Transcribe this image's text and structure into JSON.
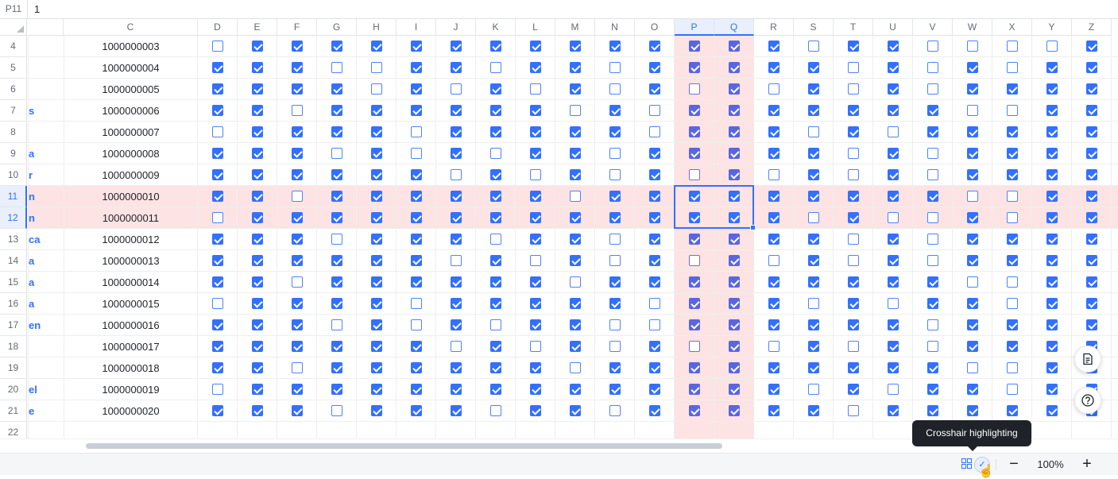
{
  "formula_bar": {
    "cell_ref": "P11",
    "value": "1"
  },
  "columns": [
    "C",
    "D",
    "E",
    "F",
    "G",
    "H",
    "I",
    "J",
    "K",
    "L",
    "M",
    "N",
    "O",
    "P",
    "Q",
    "R",
    "S",
    "T",
    "U",
    "V",
    "W",
    "X",
    "Y",
    "Z"
  ],
  "selected_columns": [
    "P",
    "Q"
  ],
  "selected_rows": [
    "11",
    "12"
  ],
  "checkbox_columns": [
    "D",
    "E",
    "F",
    "G",
    "H",
    "I",
    "J",
    "K",
    "L",
    "M",
    "N",
    "O",
    "P",
    "Q",
    "R",
    "S",
    "T",
    "U",
    "V",
    "W",
    "X",
    "Y",
    "Z"
  ],
  "rows": [
    {
      "num": "4",
      "name": "",
      "id": "1000000003",
      "checks": [
        0,
        1,
        1,
        1,
        1,
        1,
        1,
        1,
        1,
        1,
        1,
        1,
        1,
        1,
        1,
        0,
        1,
        1,
        0,
        0,
        0,
        0,
        1
      ]
    },
    {
      "num": "5",
      "name": "",
      "id": "1000000004",
      "checks": [
        1,
        1,
        1,
        0,
        0,
        1,
        1,
        0,
        1,
        1,
        0,
        1,
        1,
        1,
        1,
        1,
        0,
        1,
        0,
        1,
        0,
        1,
        1
      ]
    },
    {
      "num": "6",
      "name": "",
      "id": "1000000005",
      "checks": [
        1,
        1,
        1,
        1,
        0,
        1,
        0,
        1,
        0,
        1,
        0,
        1,
        0,
        1,
        0,
        1,
        0,
        1,
        0,
        1,
        1,
        1,
        1
      ]
    },
    {
      "num": "7",
      "name": "s",
      "id": "1000000006",
      "checks": [
        1,
        1,
        0,
        1,
        1,
        1,
        1,
        1,
        1,
        0,
        1,
        0,
        1,
        1,
        1,
        1,
        1,
        1,
        1,
        0,
        0,
        1,
        1
      ]
    },
    {
      "num": "8",
      "name": "",
      "id": "1000000007",
      "checks": [
        0,
        1,
        1,
        1,
        1,
        0,
        1,
        1,
        1,
        1,
        1,
        0,
        1,
        1,
        1,
        0,
        1,
        0,
        1,
        1,
        1,
        1,
        1
      ]
    },
    {
      "num": "9",
      "name": "a",
      "id": "1000000008",
      "checks": [
        1,
        1,
        1,
        0,
        1,
        0,
        1,
        0,
        1,
        1,
        0,
        1,
        1,
        1,
        1,
        1,
        0,
        1,
        0,
        1,
        1,
        1,
        1
      ]
    },
    {
      "num": "10",
      "name": "r",
      "id": "1000000009",
      "checks": [
        1,
        1,
        1,
        1,
        1,
        1,
        0,
        1,
        0,
        1,
        0,
        1,
        0,
        1,
        0,
        1,
        0,
        1,
        0,
        1,
        1,
        1,
        1
      ]
    },
    {
      "num": "11",
      "name": "n",
      "id": "1000000010",
      "checks": [
        1,
        1,
        0,
        1,
        1,
        1,
        1,
        1,
        1,
        0,
        1,
        1,
        1,
        1,
        1,
        1,
        1,
        1,
        1,
        0,
        0,
        1,
        1
      ]
    },
    {
      "num": "12",
      "name": "n",
      "id": "1000000011",
      "checks": [
        0,
        1,
        1,
        1,
        1,
        1,
        1,
        1,
        1,
        1,
        1,
        1,
        1,
        1,
        1,
        0,
        1,
        0,
        0,
        1,
        0,
        1,
        1
      ]
    },
    {
      "num": "13",
      "name": "ca",
      "id": "1000000012",
      "checks": [
        1,
        1,
        1,
        0,
        1,
        1,
        1,
        0,
        1,
        1,
        0,
        1,
        1,
        1,
        1,
        1,
        0,
        1,
        0,
        1,
        1,
        1,
        1
      ]
    },
    {
      "num": "14",
      "name": "a",
      "id": "1000000013",
      "checks": [
        1,
        1,
        1,
        1,
        1,
        1,
        0,
        1,
        0,
        1,
        0,
        1,
        0,
        1,
        0,
        1,
        0,
        1,
        0,
        1,
        1,
        1,
        1
      ]
    },
    {
      "num": "15",
      "name": "a",
      "id": "1000000014",
      "checks": [
        1,
        1,
        0,
        1,
        1,
        1,
        1,
        1,
        1,
        0,
        1,
        1,
        1,
        1,
        1,
        1,
        1,
        1,
        1,
        0,
        0,
        1,
        1
      ]
    },
    {
      "num": "16",
      "name": "a",
      "id": "1000000015",
      "checks": [
        0,
        1,
        1,
        1,
        1,
        0,
        1,
        1,
        1,
        1,
        1,
        0,
        1,
        1,
        1,
        0,
        1,
        0,
        1,
        1,
        0,
        1,
        1
      ]
    },
    {
      "num": "17",
      "name": "en",
      "id": "1000000016",
      "checks": [
        1,
        1,
        1,
        0,
        1,
        0,
        1,
        0,
        1,
        1,
        0,
        0,
        1,
        1,
        1,
        1,
        1,
        1,
        0,
        1,
        1,
        1,
        1
      ]
    },
    {
      "num": "18",
      "name": "",
      "id": "1000000017",
      "checks": [
        1,
        1,
        1,
        1,
        1,
        1,
        0,
        1,
        0,
        1,
        0,
        1,
        0,
        1,
        0,
        1,
        0,
        1,
        0,
        1,
        1,
        1,
        1
      ]
    },
    {
      "num": "19",
      "name": "",
      "id": "1000000018",
      "checks": [
        1,
        1,
        0,
        1,
        1,
        1,
        1,
        1,
        1,
        0,
        1,
        1,
        1,
        1,
        1,
        1,
        1,
        1,
        1,
        0,
        0,
        1,
        1
      ]
    },
    {
      "num": "20",
      "name": "el",
      "id": "1000000019",
      "checks": [
        0,
        1,
        1,
        1,
        1,
        1,
        1,
        1,
        1,
        1,
        1,
        1,
        1,
        1,
        1,
        0,
        1,
        0,
        1,
        1,
        0,
        1,
        1
      ]
    },
    {
      "num": "21",
      "name": "e",
      "id": "1000000020",
      "checks": [
        1,
        1,
        1,
        0,
        1,
        1,
        1,
        0,
        1,
        1,
        0,
        1,
        1,
        1,
        1,
        1,
        0,
        1,
        1,
        1,
        1,
        1,
        1
      ]
    },
    {
      "num": "22",
      "name": "",
      "id": "",
      "checks": []
    }
  ],
  "statusbar": {
    "zoom_out": "−",
    "zoom_level": "100%",
    "zoom_in": "+",
    "tooltip": "Crosshair highlighting"
  },
  "colors": {
    "accent": "#3370ff",
    "crosshair": "#fde3e3",
    "name_text": "#3370ff"
  }
}
